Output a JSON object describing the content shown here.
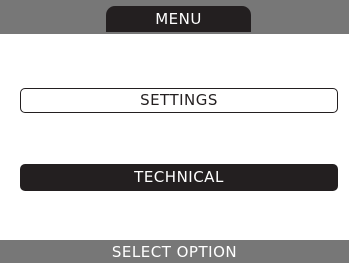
{
  "header": {
    "title": "MENU"
  },
  "menu": {
    "items": [
      {
        "label": "SETTINGS",
        "selected": false
      },
      {
        "label": "TECHNICAL",
        "selected": true
      }
    ]
  },
  "footer": {
    "status": "SELECT OPTION"
  },
  "colors": {
    "bar": "#777777",
    "dark": "#231f20",
    "background": "#ffffff"
  }
}
